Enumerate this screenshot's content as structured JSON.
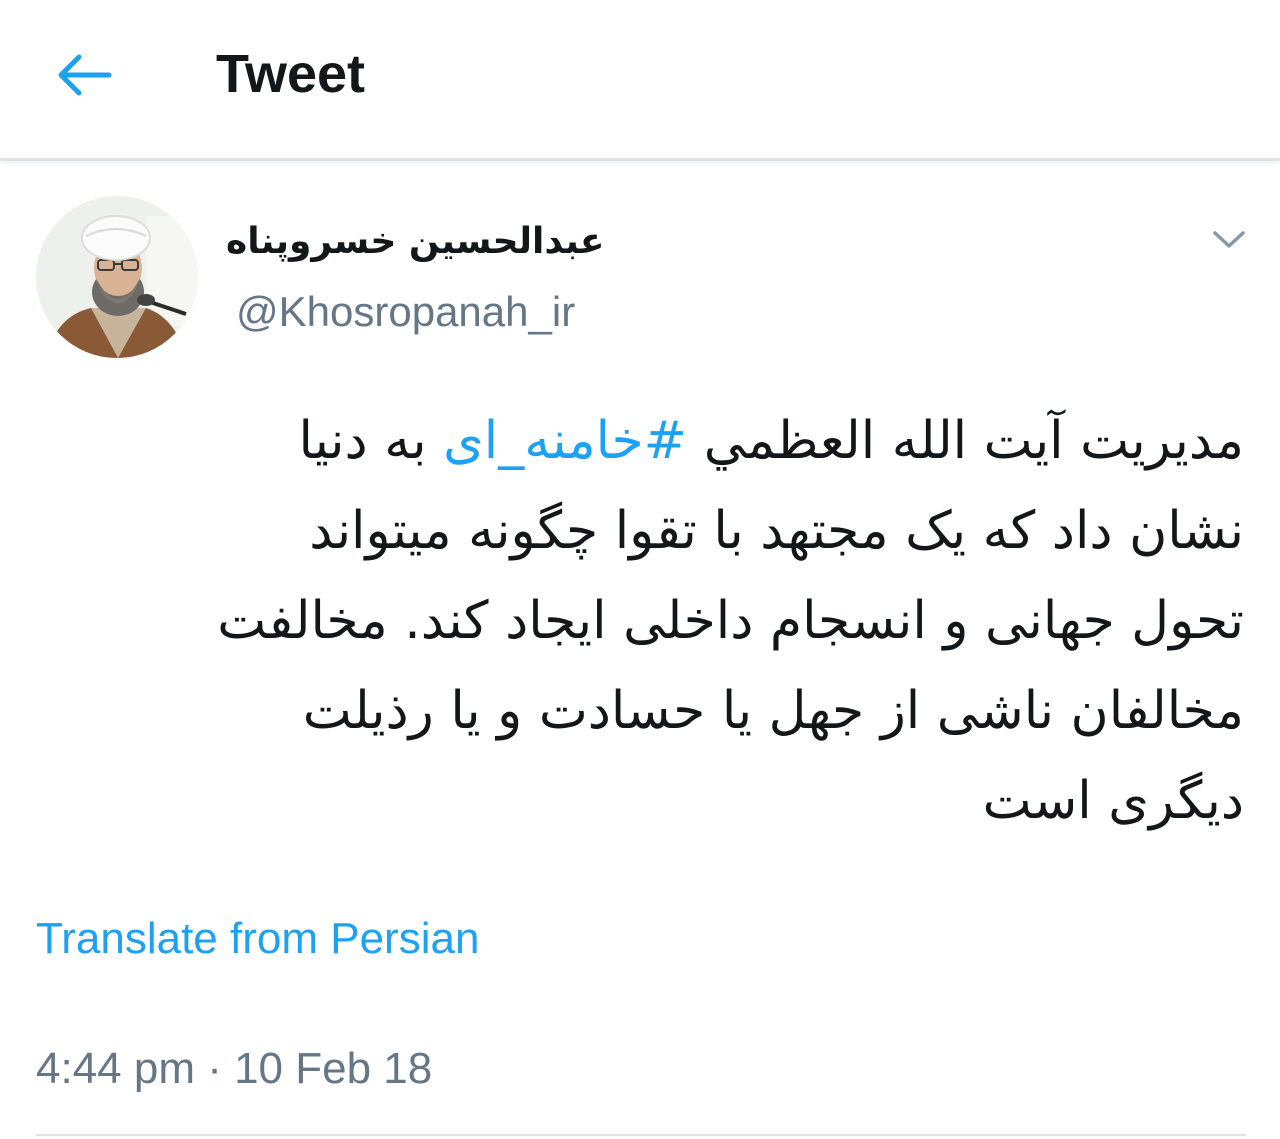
{
  "header": {
    "back_icon": "arrow-left-icon",
    "title": "Tweet"
  },
  "author": {
    "display_name": "عبدالحسین خسروپناه",
    "handle": "@Khosropanah_ir",
    "avatar_icon": "avatar-photo",
    "menu_icon": "chevron-down-icon"
  },
  "tweet": {
    "lines": [
      [
        "مدیریت آیت الله العظمي ",
        "#خامنه_ای",
        " به دنیا"
      ],
      "نشان داد که یک مجتهد با تقوا چگونه میتواند",
      "تحول جهانی و انسجام داخلی ایجاد کند. مخالفت",
      "مخالفان ناشی از جهل یا حسادت و یا رذیلت",
      "دیگری است"
    ],
    "line1_before": "مدیریت آیت الله العظمي ",
    "hashtag": "#خامنه_ای",
    "line1_after": " به دنیا",
    "line2": "نشان داد که یک مجتهد با تقوا چگونه میتواند",
    "line3": "تحول جهانی و انسجام داخلی ایجاد کند. مخالفت",
    "line4": "مخالفان ناشی از جهل یا حسادت و یا رذیلت",
    "line5": "دیگری است"
  },
  "translate_label": "Translate from Persian",
  "timestamp": "4:44 pm · 10 Feb 18",
  "colors": {
    "accent": "#1da1f2",
    "secondary_text": "#657786",
    "primary_text": "#14171a",
    "divider": "#dde2e6"
  }
}
